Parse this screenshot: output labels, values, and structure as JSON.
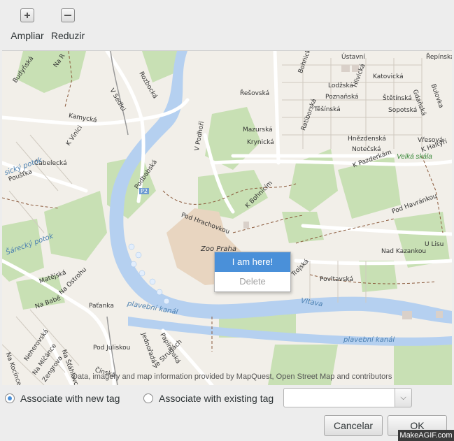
{
  "toolbar": {
    "zoom_in_label": "Ampliar",
    "zoom_out_label": "Reduzir"
  },
  "map": {
    "streets": [
      "Budyňská",
      "Na R",
      "Rozbocká",
      "V Sedlci",
      "Kamycká",
      "K Vinici",
      "Čabelecká",
      "Poušťka",
      "Podbabská",
      "V Podhoří",
      "Řešovská",
      "Mazurská",
      "Krynická",
      "K Bohnicím",
      "Pod Hrachovkou",
      "Ústavní",
      "Bohnická",
      "Řepínská",
      "Katovická",
      "Lodžská",
      "Hlivická",
      "Poznaňská",
      "Štětínská",
      "Gdaňská",
      "Bulovka",
      "Těšínská",
      "Sopotská",
      "Ratiborská",
      "Hnězdenská",
      "Notečská",
      "Vřesová",
      "K Haltýři",
      "K Pazderkám",
      "Pod Havránkou",
      "U Lisu",
      "Nad Kazankou",
      "Povltavská",
      "Trojská",
      "Matějská",
      "Na Ostrohu",
      "Na Babě",
      "Paťanka",
      "Papírenská",
      "Jednořadá",
      "Ve Struhách",
      "Pod Juliskou",
      "Neherovská",
      "Na Míčánce",
      "Zengrova",
      "Čínská",
      "Na Šťáhlavce",
      "Na Kocínce"
    ],
    "water_labels": [
      "sický potok",
      "Šárecký potok",
      "Vltava",
      "plavební kanál",
      "plavební kanál"
    ],
    "place_labels": [
      "Zoo Praha",
      "Velká skála",
      "P2"
    ],
    "attribution": "Data, imagery and map information provided by MapQuest, Open Street Map and contributors"
  },
  "context_menu": {
    "items": [
      {
        "label": "I am here!",
        "state": "highlighted"
      },
      {
        "label": "Delete",
        "state": "disabled"
      }
    ]
  },
  "associate": {
    "new_tag_label": "Associate with new tag",
    "existing_tag_label": "Associate with existing tag",
    "selected": "new",
    "existing_tag_value": ""
  },
  "buttons": {
    "cancel": "Cancelar",
    "ok": "OK"
  },
  "watermark": "MakeAGIF.com",
  "colors": {
    "water": "#b5d0f0",
    "park": "#c8e0b4",
    "road": "#ffffff",
    "accent": "#4a90d9"
  }
}
